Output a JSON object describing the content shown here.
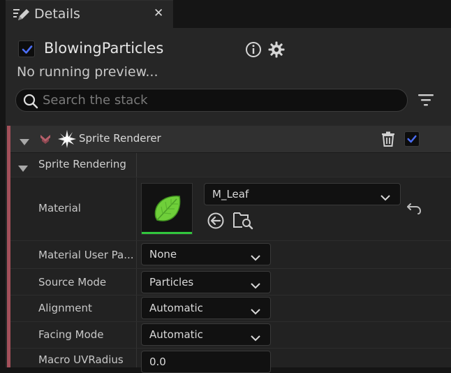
{
  "tab": {
    "title": "Details",
    "close_glyph": "✕",
    "icon": "details-pencil-icon"
  },
  "header": {
    "system_name": "BlowingParticles",
    "enabled": true,
    "preview_status": "No running preview...",
    "icons": [
      "info-icon",
      "gear-icon"
    ]
  },
  "search": {
    "placeholder": "Search the stack",
    "value": ""
  },
  "module": {
    "title": "Sprite Renderer",
    "enabled": true,
    "icons": [
      "collapse-arrow-icon",
      "stage-icon",
      "sprite-burst-icon",
      "trash-icon"
    ]
  },
  "section": {
    "title": "Sprite Rendering"
  },
  "properties": {
    "material": {
      "label": "Material",
      "value": "M_Leaf",
      "thumbnail": "leaf-thumbnail"
    },
    "material_user_param": {
      "label": "Material User Pa...",
      "value": "None"
    },
    "source_mode": {
      "label": "Source Mode",
      "value": "Particles"
    },
    "alignment": {
      "label": "Alignment",
      "value": "Automatic"
    },
    "facing_mode": {
      "label": "Facing Mode",
      "value": "Automatic"
    },
    "macro_uv_radius": {
      "label": "Macro UVRadius",
      "value": "0.0"
    }
  },
  "colors": {
    "accent_check": "#4c6ef5",
    "stripe": "#a3505a",
    "thumb_bar": "#31c63d",
    "leaf": "#6fcf3a"
  }
}
